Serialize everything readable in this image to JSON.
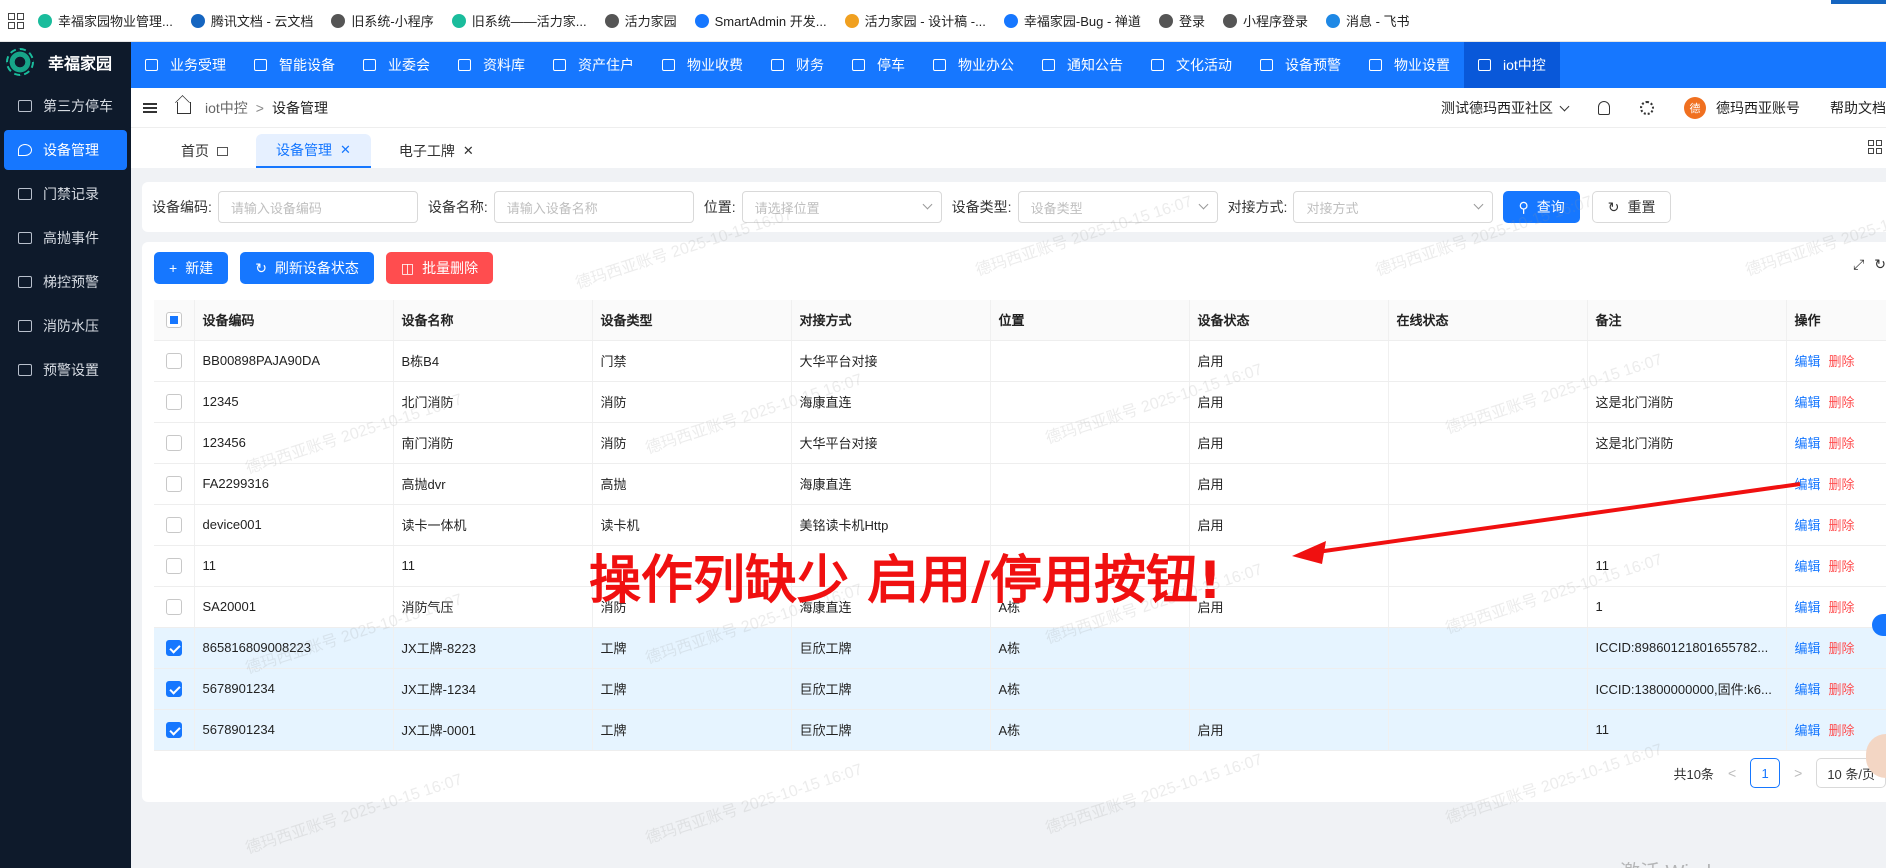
{
  "bookmarks": [
    {
      "label": "幸福家园物业管理...",
      "color": "#1abc9c"
    },
    {
      "label": "腾讯文档 - 云文档",
      "color": "#1565c0"
    },
    {
      "label": "旧系统-小程序",
      "color": "#555555"
    },
    {
      "label": "旧系统——活力家...",
      "color": "#1abc9c"
    },
    {
      "label": "活力家园",
      "color": "#555555"
    },
    {
      "label": "SmartAdmin 开发...",
      "color": "#1677ff"
    },
    {
      "label": "活力家园 - 设计稿 -...",
      "color": "#f0a020"
    },
    {
      "label": "幸福家园-Bug - 禅道",
      "color": "#1677ff"
    },
    {
      "label": "登录",
      "color": "#555555"
    },
    {
      "label": "小程序登录",
      "color": "#555555"
    },
    {
      "label": "消息 - 飞书",
      "color": "#1e88e5"
    }
  ],
  "app": {
    "name": "幸福家园"
  },
  "sidebar": {
    "items": [
      {
        "label": "第三方停车",
        "icon": "car-icon",
        "active": false
      },
      {
        "label": "设备管理",
        "icon": "bulb-icon",
        "active": true
      },
      {
        "label": "门禁记录",
        "icon": "card-icon",
        "active": false
      },
      {
        "label": "高抛事件",
        "icon": "trend-icon",
        "active": false
      },
      {
        "label": "梯控预警",
        "icon": "elevator-icon",
        "active": false
      },
      {
        "label": "消防水压",
        "icon": "fire-icon",
        "active": false
      },
      {
        "label": "预警设置",
        "icon": "alarm-icon",
        "active": false
      }
    ]
  },
  "topnav": {
    "items": [
      {
        "label": "业务受理",
        "active": false
      },
      {
        "label": "智能设备",
        "active": false
      },
      {
        "label": "业委会",
        "active": false
      },
      {
        "label": "资料库",
        "active": false
      },
      {
        "label": "资产住户",
        "active": false
      },
      {
        "label": "物业收费",
        "active": false
      },
      {
        "label": "财务",
        "active": false
      },
      {
        "label": "停车",
        "active": false
      },
      {
        "label": "物业办公",
        "active": false
      },
      {
        "label": "通知公告",
        "active": false
      },
      {
        "label": "文化活动",
        "active": false
      },
      {
        "label": "设备预警",
        "active": false
      },
      {
        "label": "物业设置",
        "active": false
      },
      {
        "label": "iot中控",
        "active": true
      }
    ]
  },
  "header": {
    "breadcrumb_parent": "iot中控",
    "breadcrumb_sep": ">",
    "breadcrumb_current": "设备管理",
    "community": "测试德玛西亚社区",
    "avatar_text": "德",
    "account": "德玛西亚账号",
    "help": "帮助文档"
  },
  "tabs": [
    {
      "label": "首页",
      "closable": false,
      "active": false
    },
    {
      "label": "设备管理",
      "closable": true,
      "active": true
    },
    {
      "label": "电子工牌",
      "closable": true,
      "active": false
    }
  ],
  "search": {
    "code_label": "设备编码:",
    "code_placeholder": "请输入设备编码",
    "name_label": "设备名称:",
    "name_placeholder": "请输入设备名称",
    "location_label": "位置:",
    "location_placeholder": "请选择位置",
    "type_label": "设备类型:",
    "type_placeholder": "设备类型",
    "method_label": "对接方式:",
    "method_placeholder": "对接方式",
    "query": "查询",
    "reset": "重置"
  },
  "toolbar": {
    "new": "新建",
    "refresh": "刷新设备状态",
    "batch_delete": "批量删除"
  },
  "table": {
    "columns": [
      "设备编码",
      "设备名称",
      "设备类型",
      "对接方式",
      "位置",
      "设备状态",
      "在线状态",
      "备注",
      "操作"
    ],
    "edit_label": "编辑",
    "delete_label": "删除",
    "rows": [
      {
        "selected": false,
        "cells": [
          "BB00898PAJA90DA",
          "B栋B4",
          "门禁",
          "大华平台对接",
          "",
          "启用",
          "",
          ""
        ]
      },
      {
        "selected": false,
        "cells": [
          "12345",
          "北门消防",
          "消防",
          "海康直连",
          "",
          "启用",
          "",
          "这是北门消防"
        ]
      },
      {
        "selected": false,
        "cells": [
          "123456",
          "南门消防",
          "消防",
          "大华平台对接",
          "",
          "启用",
          "",
          "这是北门消防"
        ]
      },
      {
        "selected": false,
        "cells": [
          "FA2299316",
          "高抛dvr",
          "高抛",
          "海康直连",
          "",
          "启用",
          "",
          ""
        ]
      },
      {
        "selected": false,
        "cells": [
          "device001",
          "读卡一体机",
          "读卡机",
          "美铭读卡机Http",
          "",
          "启用",
          "",
          ""
        ]
      },
      {
        "selected": false,
        "cells": [
          "11",
          "11",
          "",
          "",
          "",
          "",
          "",
          "11"
        ]
      },
      {
        "selected": false,
        "cells": [
          "SA20001",
          "消防气压",
          "消防",
          "海康直连",
          "A栋",
          "启用",
          "",
          "1"
        ]
      },
      {
        "selected": true,
        "cells": [
          "865816809008223",
          "JX工牌-8223",
          "工牌",
          "巨欣工牌",
          "A栋",
          "",
          "",
          "ICCID:89860121801655782..."
        ]
      },
      {
        "selected": true,
        "cells": [
          "5678901234",
          "JX工牌-1234",
          "工牌",
          "巨欣工牌",
          "A栋",
          "",
          "",
          "ICCID:13800000000,固件:k6..."
        ]
      },
      {
        "selected": true,
        "cells": [
          "5678901234",
          "JX工牌-0001",
          "工牌",
          "巨欣工牌",
          "A栋",
          "启用",
          "",
          "11"
        ]
      }
    ]
  },
  "pagination": {
    "total": "共10条",
    "prev": "<",
    "page": "1",
    "next": ">",
    "size": "10 条/页"
  },
  "annotation": {
    "text": "操作列缺少 启用/停用按钮!",
    "color": "#f01010"
  },
  "watermark": "德玛西亚账号 2025-10-15 16:07",
  "os_watermark": "激活 Windows",
  "colors": {
    "primary": "#1677ff",
    "danger": "#ff4d4f",
    "sidebar": "#0e1a2b"
  }
}
